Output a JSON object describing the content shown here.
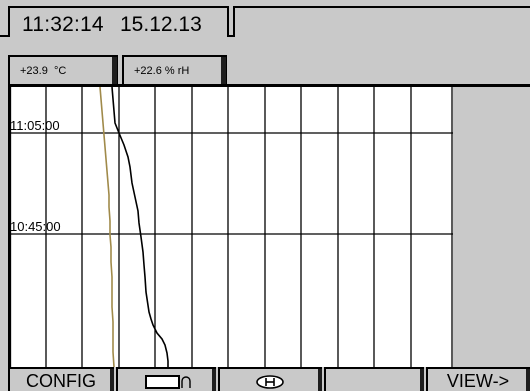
{
  "header": {
    "time": "11:32:14",
    "date": "15.12.13"
  },
  "channels": [
    {
      "label": "+23.9  °C",
      "color": "#a08a4a"
    },
    {
      "label": "+22.6 % rH",
      "color": "#000000"
    }
  ],
  "plot": {
    "time_labels": [
      "11:05:00",
      "10:45:00"
    ]
  },
  "softkeys": {
    "config": "CONFIG",
    "scale_icon": "rectangle-arc-icon",
    "hold_icon": "hold-h-icon",
    "blank": "",
    "view": "VIEW->"
  }
}
